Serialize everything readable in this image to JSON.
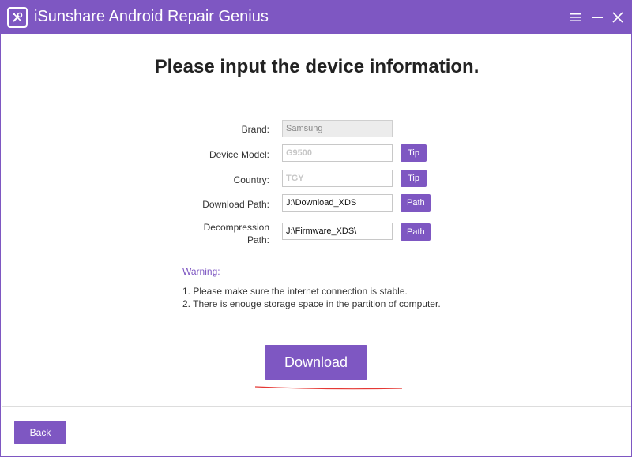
{
  "app": {
    "title": "iSunshare Android Repair Genius",
    "logo_icon": "wrench-screwdriver-icon",
    "accent_color": "#7e57c2"
  },
  "window_controls": [
    {
      "name": "menu-icon",
      "glyph": "≡"
    },
    {
      "name": "minimize-icon",
      "glyph": "—"
    },
    {
      "name": "close-icon",
      "glyph": "✕"
    }
  ],
  "page": {
    "title": "Please input the device information."
  },
  "form": {
    "brand": {
      "label": "Brand:",
      "value": "Samsung"
    },
    "device_model": {
      "label": "Device Model:",
      "value": "G9500",
      "tip_label": "Tip"
    },
    "country": {
      "label": "Country:",
      "value": "TGY",
      "tip_label": "Tip"
    },
    "download_path": {
      "label": "Download Path:",
      "value": "J:\\Download_XDS",
      "button_label": "Path"
    },
    "decompression_path": {
      "label_line1": "Decompression",
      "label_line2": "Path:",
      "value": "J:\\Firmware_XDS\\",
      "button_label": "Path"
    }
  },
  "warning": {
    "title": "Warning:",
    "lines": [
      "1. Please make sure the internet connection is stable.",
      "2. There is enouge storage space in the partition of computer."
    ]
  },
  "actions": {
    "download_label": "Download",
    "back_label": "Back"
  }
}
